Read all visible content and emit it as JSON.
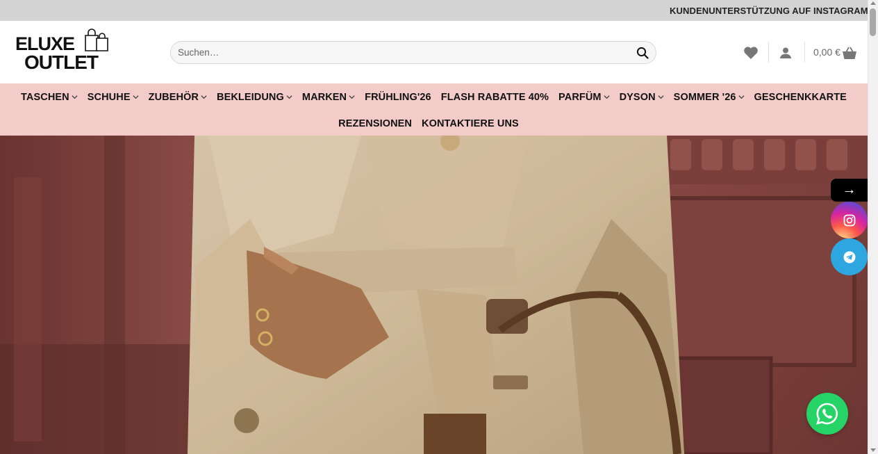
{
  "announcement": {
    "text": "KUNDENUNTERSTÜTZUNG AUF INSTAGRAM UND TELEGRAM"
  },
  "logo": {
    "line1": "ELUXE",
    "line2": "OUTLET"
  },
  "search": {
    "placeholder": "Suchen…",
    "value": ""
  },
  "header": {
    "wishlist_icon": "heart-icon",
    "account_icon": "user-icon",
    "cart_total": "0,00 €",
    "cart_icon": "shopping-basket-icon"
  },
  "nav": {
    "row1": [
      {
        "label": "TASCHEN",
        "has_dropdown": true
      },
      {
        "label": "SCHUHE",
        "has_dropdown": true
      },
      {
        "label": "ZUBEHÖR",
        "has_dropdown": true
      },
      {
        "label": "BEKLEIDUNG",
        "has_dropdown": true
      },
      {
        "label": "MARKEN",
        "has_dropdown": true
      },
      {
        "label": "FRÜHLING'26",
        "has_dropdown": false
      },
      {
        "label": "FLASH RABATTE 40%",
        "has_dropdown": false
      },
      {
        "label": "PARFÜM",
        "has_dropdown": true
      },
      {
        "label": "DYSON",
        "has_dropdown": true
      },
      {
        "label": "SOMMER '26",
        "has_dropdown": true
      },
      {
        "label": "GESCHENKKARTE",
        "has_dropdown": false
      }
    ],
    "row2": [
      {
        "label": "REZENSIONEN",
        "has_dropdown": false
      },
      {
        "label": "KONTAKTIERE UNS",
        "has_dropdown": false
      }
    ]
  },
  "floating": {
    "toggle_arrow": "→",
    "instagram_icon": "instagram-icon",
    "telegram_icon": "telegram-icon",
    "whatsapp_icon": "whatsapp-icon"
  },
  "colors": {
    "topbar_bg": "#d3d3d3",
    "nav_bg": "#f3cbc9",
    "whatsapp_green": "#25d366",
    "telegram_blue": "#2ea6df"
  }
}
